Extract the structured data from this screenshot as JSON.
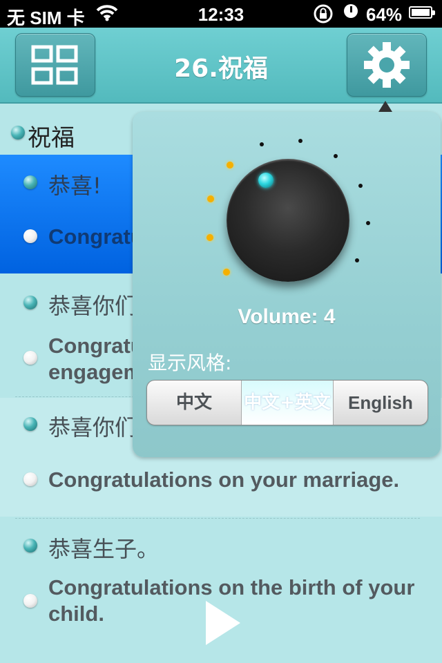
{
  "status_bar": {
    "carrier": "无 SIM 卡",
    "time": "12:33",
    "battery": "64%"
  },
  "header": {
    "title": "26.祝福",
    "menu_icon": "grid-icon",
    "settings_icon": "gear-icon"
  },
  "section": {
    "heading": "祝福"
  },
  "items": [
    {
      "cn": "恭喜!",
      "en": "Congratulations!"
    },
    {
      "cn": "恭喜你们订婚",
      "en": "Congratulations on your engagement."
    },
    {
      "cn": "恭喜你们喜结良缘",
      "en": "Congratulations on your marriage."
    },
    {
      "cn": "恭喜生子。",
      "en": "Congratulations on the birth of your child."
    }
  ],
  "settings_popover": {
    "volume_label": "Volume: 4",
    "volume_level": 4,
    "volume_max": 10,
    "display_style_label": "显示风格:",
    "display_options": [
      "中文",
      "中文+英文",
      "English"
    ],
    "selected_option": "中文+英文"
  },
  "colors": {
    "accent_teal": "#5cc2c6",
    "selected_row": "#0a72f0",
    "list_background": "#b6e6e8"
  }
}
